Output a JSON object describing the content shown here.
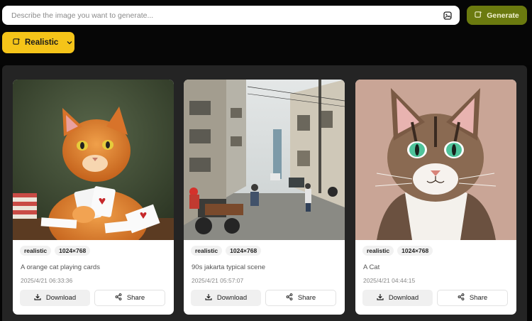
{
  "prompt": {
    "placeholder": "Describe the image you want to generate..."
  },
  "generate": {
    "label": "Generate",
    "bg": "#6b7a0f"
  },
  "style_selector": {
    "label": "Realistic",
    "bg": "#f5c419"
  },
  "cards": [
    {
      "tags": [
        "realistic",
        "1024×768"
      ],
      "caption": "A orange cat playing cards",
      "time": "2025/4/21 06:33:36",
      "download": "Download",
      "share": "Share",
      "image": "orange-cat-playing-cards"
    },
    {
      "tags": [
        "realistic",
        "1024×768"
      ],
      "caption": "90s jakarta typical scene",
      "time": "2025/4/21 05:57:07",
      "download": "Download",
      "share": "Share",
      "image": "jakarta-street-scene"
    },
    {
      "tags": [
        "realistic",
        "1024×768"
      ],
      "caption": "A Cat",
      "time": "2025/4/21 04:44:15",
      "download": "Download",
      "share": "Share",
      "image": "tabby-cat-portrait"
    }
  ]
}
